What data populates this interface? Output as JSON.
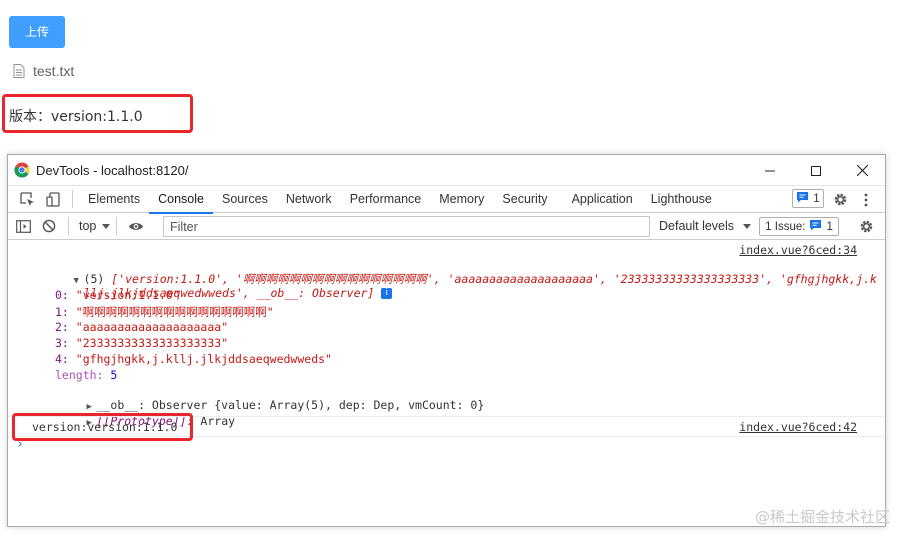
{
  "page": {
    "upload_label": "上传",
    "file_name": "test.txt",
    "version_text": "版本：version:1.1.0"
  },
  "devtools": {
    "window_title": "DevTools - localhost:8120/",
    "tabs": [
      "Elements",
      "Console",
      "Sources",
      "Network",
      "Performance",
      "Memory",
      "Security",
      "Application",
      "Lighthouse"
    ],
    "active_tab": "Console",
    "message_count": "1",
    "context": "top",
    "filter_placeholder": "Filter",
    "levels_label": "Default levels",
    "issues_label": "1 Issue:",
    "issues_count": "1"
  },
  "console": {
    "entry1": {
      "source": "index.vue?6ced:34",
      "summary_count": "(5)",
      "summary_line1": "['version:1.1.0', '啊啊啊啊啊啊啊啊啊啊啊啊啊啊啊啊', 'aaaaaaaaaaaaaaaaaaaa', '23333333333333333333', 'gfhgjhgkk,j.k",
      "summary_line2": "llj.jlkjddsaeqwedwweds', __ob__: Observer]",
      "items": [
        {
          "key": "0:",
          "value": "\"version:1.1.0\""
        },
        {
          "key": "1:",
          "value": "\"啊啊啊啊啊啊啊啊啊啊啊啊啊啊啊啊\""
        },
        {
          "key": "2:",
          "value": "\"aaaaaaaaaaaaaaaaaaaa\""
        },
        {
          "key": "3:",
          "value": "\"23333333333333333333\""
        },
        {
          "key": "4:",
          "value": "\"gfhgjhgkk,j.kllj.jlkjddsaeqwedwweds\""
        }
      ],
      "length_key": "length:",
      "length_value": "5",
      "ob_line": "__ob__: Observer {value: Array(5), dep: Dep, vmCount: 0}",
      "prototype_key": "[[Prototype]]:",
      "prototype_value": "Array"
    },
    "entry2": {
      "text": "version:version:1.1.0",
      "source": "index.vue?6ced:42"
    },
    "prompt": "›"
  },
  "watermark": "@稀土掘金技术社区",
  "colors": {
    "upload_button": "#409eff",
    "highlight_box": "#e8262b",
    "devtools_accent": "#1a73e8",
    "string_value": "#c41a16",
    "property_key": "#881280",
    "number_value": "#1c00cf"
  }
}
